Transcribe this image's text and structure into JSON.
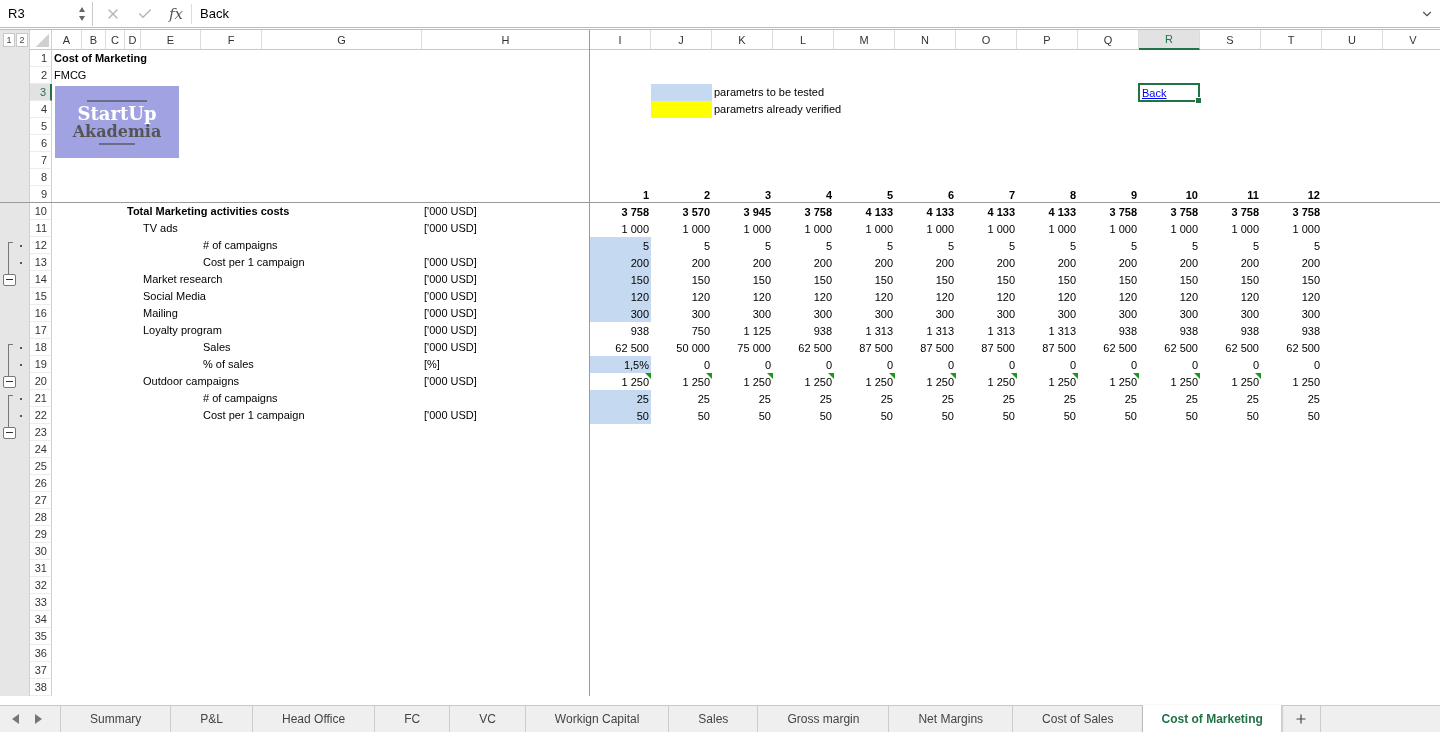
{
  "formula_bar": {
    "name_box": "R3",
    "function_label": "fx",
    "formula": "Back"
  },
  "outline_levels": [
    "1",
    "2"
  ],
  "columns": [
    {
      "label": "A",
      "selected": false
    },
    {
      "label": "B",
      "selected": false
    },
    {
      "label": "C",
      "selected": false
    },
    {
      "label": "D",
      "selected": false
    },
    {
      "label": "E",
      "selected": false
    },
    {
      "label": "F",
      "selected": false
    },
    {
      "label": "G",
      "selected": false
    },
    {
      "label": "H",
      "selected": false
    },
    {
      "label": "I",
      "selected": false
    },
    {
      "label": "J",
      "selected": false
    },
    {
      "label": "K",
      "selected": false
    },
    {
      "label": "L",
      "selected": false
    },
    {
      "label": "M",
      "selected": false
    },
    {
      "label": "N",
      "selected": false
    },
    {
      "label": "O",
      "selected": false
    },
    {
      "label": "P",
      "selected": false
    },
    {
      "label": "Q",
      "selected": false
    },
    {
      "label": "R",
      "selected": true
    },
    {
      "label": "S",
      "selected": false
    },
    {
      "label": "T",
      "selected": false
    },
    {
      "label": "U",
      "selected": false
    },
    {
      "label": "V",
      "selected": false
    }
  ],
  "row_headers": [
    {
      "label": "1",
      "selected": false
    },
    {
      "label": "2",
      "selected": false
    },
    {
      "label": "3",
      "selected": true
    },
    {
      "label": "4",
      "selected": false
    },
    {
      "label": "5",
      "selected": false
    },
    {
      "label": "6",
      "selected": false
    },
    {
      "label": "7",
      "selected": false
    },
    {
      "label": "8",
      "selected": false
    },
    {
      "label": "9",
      "selected": false
    },
    {
      "label": "10",
      "selected": false
    },
    {
      "label": "11",
      "selected": false
    },
    {
      "label": "12",
      "selected": false
    },
    {
      "label": "13",
      "selected": false
    },
    {
      "label": "14",
      "selected": false
    },
    {
      "label": "15",
      "selected": false
    },
    {
      "label": "16",
      "selected": false
    },
    {
      "label": "17",
      "selected": false
    },
    {
      "label": "18",
      "selected": false
    },
    {
      "label": "19",
      "selected": false
    },
    {
      "label": "20",
      "selected": false
    },
    {
      "label": "21",
      "selected": false
    },
    {
      "label": "22",
      "selected": false
    },
    {
      "label": "23",
      "selected": false
    },
    {
      "label": "24",
      "selected": false
    },
    {
      "label": "25",
      "selected": false
    },
    {
      "label": "26",
      "selected": false
    },
    {
      "label": "27",
      "selected": false
    },
    {
      "label": "28",
      "selected": false
    },
    {
      "label": "29",
      "selected": false
    },
    {
      "label": "30",
      "selected": false
    },
    {
      "label": "31",
      "selected": false
    },
    {
      "label": "32",
      "selected": false
    },
    {
      "label": "33",
      "selected": false
    },
    {
      "label": "34",
      "selected": false
    },
    {
      "label": "35",
      "selected": false
    },
    {
      "label": "36",
      "selected": false
    },
    {
      "label": "37",
      "selected": false
    },
    {
      "label": "38",
      "selected": false
    }
  ],
  "title": "Cost of Marketing",
  "subtitle": "FMCG",
  "logo": {
    "line_1": "StartUp",
    "line_2": "Akademia"
  },
  "legend": [
    {
      "label": "parametrs to be tested",
      "color": "#c5d9f1"
    },
    {
      "label": "parametrs already verified",
      "color": "#ffff00"
    }
  ],
  "link_cell": {
    "label": "Back",
    "selected": true
  },
  "periods": [
    "1",
    "2",
    "3",
    "4",
    "5",
    "6",
    "7",
    "8",
    "9",
    "10",
    "11",
    "12"
  ],
  "data_rows": [
    {
      "kind": "total",
      "label": "Total Marketing activities costs",
      "unit": "['000 USD]",
      "grouped": false,
      "tested": false,
      "values": [
        "3 758",
        "3 570",
        "3 945",
        "3 758",
        "4 133",
        "4 133",
        "4 133",
        "4 133",
        "3 758",
        "3 758",
        "3 758",
        "3 758"
      ]
    },
    {
      "kind": "item",
      "label": "TV ads",
      "unit": "['000 USD]",
      "grouped": false,
      "tested": false,
      "values": [
        "1 000",
        "1 000",
        "1 000",
        "1 000",
        "1 000",
        "1 000",
        "1 000",
        "1 000",
        "1 000",
        "1 000",
        "1 000",
        "1 000"
      ]
    },
    {
      "kind": "driver",
      "label": "# of campaigns",
      "grouped": true,
      "tested": true,
      "values": [
        "5",
        "5",
        "5",
        "5",
        "5",
        "5",
        "5",
        "5",
        "5",
        "5",
        "5",
        "5"
      ]
    },
    {
      "kind": "driver",
      "label": "Cost per 1 campaign",
      "unit": "['000 USD]",
      "grouped": true,
      "tested": true,
      "values": [
        "200",
        "200",
        "200",
        "200",
        "200",
        "200",
        "200",
        "200",
        "200",
        "200",
        "200",
        "200"
      ]
    },
    {
      "kind": "item",
      "label": "Market research",
      "unit": "['000 USD]",
      "grouped": false,
      "tested": true,
      "values": [
        "150",
        "150",
        "150",
        "150",
        "150",
        "150",
        "150",
        "150",
        "150",
        "150",
        "150",
        "150"
      ]
    },
    {
      "kind": "item",
      "label": "Social Media",
      "unit": "['000 USD]",
      "grouped": false,
      "tested": true,
      "values": [
        "120",
        "120",
        "120",
        "120",
        "120",
        "120",
        "120",
        "120",
        "120",
        "120",
        "120",
        "120"
      ]
    },
    {
      "kind": "item",
      "label": "Mailing",
      "unit": "['000 USD]",
      "grouped": false,
      "tested": true,
      "values": [
        "300",
        "300",
        "300",
        "300",
        "300",
        "300",
        "300",
        "300",
        "300",
        "300",
        "300",
        "300"
      ]
    },
    {
      "kind": "item",
      "label": "Loyalty program",
      "unit": "['000 USD]",
      "grouped": false,
      "tested": false,
      "values": [
        "938",
        "750",
        "1 125",
        "938",
        "1 313",
        "1 313",
        "1 313",
        "1 313",
        "938",
        "938",
        "938",
        "938"
      ]
    },
    {
      "kind": "driver",
      "label": "Sales",
      "unit": "['000 USD]",
      "grouped": true,
      "tested": false,
      "values": [
        "62 500",
        "50 000",
        "75 000",
        "62 500",
        "87 500",
        "87 500",
        "87 500",
        "87 500",
        "62 500",
        "62 500",
        "62 500",
        "62 500"
      ]
    },
    {
      "kind": "driver",
      "label": "% of sales",
      "unit": "[%]",
      "grouped": true,
      "tested": true,
      "values": [
        "1,5%",
        "0",
        "0",
        "0",
        "0",
        "0",
        "0",
        "0",
        "0",
        "0",
        "0",
        "0"
      ]
    },
    {
      "kind": "item",
      "label": "Outdoor campaigns",
      "unit": "['000 USD]",
      "grouped": false,
      "tested": false,
      "values": [
        "1 250",
        "1 250",
        "1 250",
        "1 250",
        "1 250",
        "1 250",
        "1 250",
        "1 250",
        "1 250",
        "1 250",
        "1 250",
        "1 250"
      ],
      "flags": [
        true,
        true,
        true,
        true,
        true,
        true,
        true,
        true,
        true,
        true,
        true,
        false
      ]
    },
    {
      "kind": "driver",
      "label": "# of campaigns",
      "grouped": true,
      "tested": true,
      "values": [
        "25",
        "25",
        "25",
        "25",
        "25",
        "25",
        "25",
        "25",
        "25",
        "25",
        "25",
        "25"
      ]
    },
    {
      "kind": "driver",
      "label": "Cost per 1 campaign",
      "unit": "['000 USD]",
      "grouped": true,
      "tested": true,
      "values": [
        "50",
        "50",
        "50",
        "50",
        "50",
        "50",
        "50",
        "50",
        "50",
        "50",
        "50",
        "50"
      ]
    }
  ],
  "sheet_tabs": [
    {
      "label": "Summary",
      "selected": false
    },
    {
      "label": "P&L",
      "selected": false
    },
    {
      "label": "Head Office",
      "selected": false
    },
    {
      "label": "FC",
      "selected": false
    },
    {
      "label": "VC",
      "selected": false
    },
    {
      "label": "Workign Capital",
      "selected": false
    },
    {
      "label": "Sales",
      "selected": false
    },
    {
      "label": "Gross margin",
      "selected": false
    },
    {
      "label": "Net Margins",
      "selected": false
    },
    {
      "label": "Cost of Sales",
      "selected": false
    },
    {
      "label": "Cost of Marketing",
      "selected": true
    }
  ]
}
